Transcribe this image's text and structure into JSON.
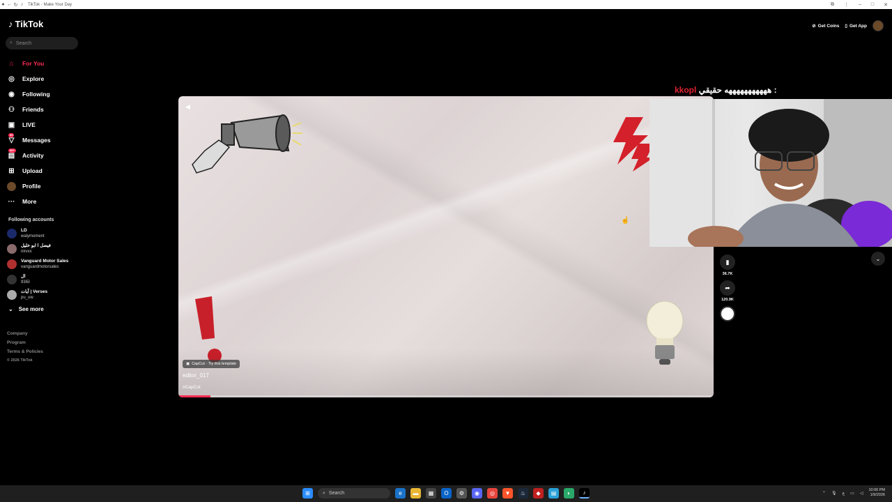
{
  "window": {
    "title": "TikTok - Make Your Day"
  },
  "brand": {
    "name": "TikTok"
  },
  "search": {
    "placeholder": "Search"
  },
  "nav": [
    {
      "label": "For You",
      "icon": "home-icon",
      "active": true
    },
    {
      "label": "Explore",
      "icon": "compass-icon"
    },
    {
      "label": "Following",
      "icon": "following-avatar-icon"
    },
    {
      "label": "Friends",
      "icon": "friends-icon"
    },
    {
      "label": "LIVE",
      "icon": "live-icon"
    },
    {
      "label": "Messages",
      "icon": "messages-icon",
      "badge": "39"
    },
    {
      "label": "Activity",
      "icon": "activity-icon",
      "badge": "99+"
    },
    {
      "label": "Upload",
      "icon": "upload-icon"
    },
    {
      "label": "Profile",
      "icon": "profile-avatar-icon"
    },
    {
      "label": "More",
      "icon": "more-icon"
    }
  ],
  "following_accounts": {
    "title": "Following accounts",
    "accounts": [
      {
        "name": "LD",
        "handle": "walymoment"
      },
      {
        "name": "فيصل ا ابو خليل",
        "handle": "nirvxx"
      },
      {
        "name": "Vanguard Motor Sales",
        "handle": "vanguardmotorsales"
      },
      {
        "name": "ال",
        "handle": "93i5l"
      },
      {
        "name": "آيات | Verses",
        "handle": "pu_uw"
      }
    ],
    "see_more": "See more"
  },
  "footer": {
    "links": [
      "Company",
      "Program",
      "Terms & Policies"
    ],
    "copyright": "© 2026 TikTok"
  },
  "top_right": {
    "coins": "Get Coins",
    "app": "Get App"
  },
  "video": {
    "capcut_label": "CapCut · Try this template",
    "username": "editor_017",
    "hashtag": "#CapCut",
    "progress": 0.06
  },
  "overlay": {
    "name": "kkopl",
    "text": "هههههههههههه حقيقي :"
  },
  "actions": {
    "bookmarks": "36.7K",
    "shares": "120.9K"
  },
  "taskbar": {
    "search": "Search",
    "time": "10:00 PM",
    "date": "1/9/2026"
  }
}
